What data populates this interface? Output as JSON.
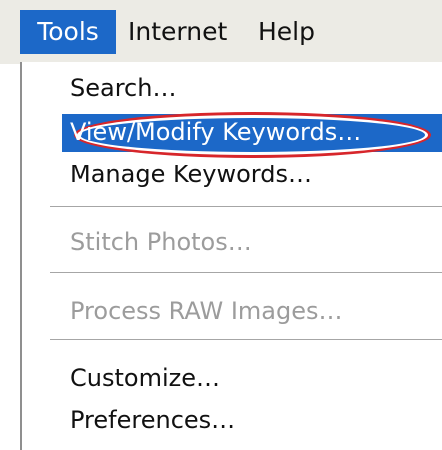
{
  "menubar": {
    "items": [
      {
        "label": "Tools",
        "active": true
      },
      {
        "label": "Internet"
      },
      {
        "label": "Help"
      }
    ]
  },
  "tools_menu": {
    "items": [
      {
        "label": "Search…",
        "enabled": true
      },
      {
        "label": "View/Modify Keywords…",
        "enabled": true,
        "highlighted": true,
        "annotated": "red-oval"
      },
      {
        "label": "Manage Keywords…",
        "enabled": true
      },
      {
        "label": "Stitch Photos…",
        "enabled": false
      },
      {
        "label": "Process RAW Images…",
        "enabled": false
      },
      {
        "label": "Customize…",
        "enabled": true
      },
      {
        "label": "Preferences…",
        "enabled": true
      }
    ]
  },
  "colors": {
    "selection": "#1c68c8",
    "annotation": "#d7262b",
    "menubar_bg": "#ecebe5",
    "disabled_text": "#9c9c9c"
  }
}
